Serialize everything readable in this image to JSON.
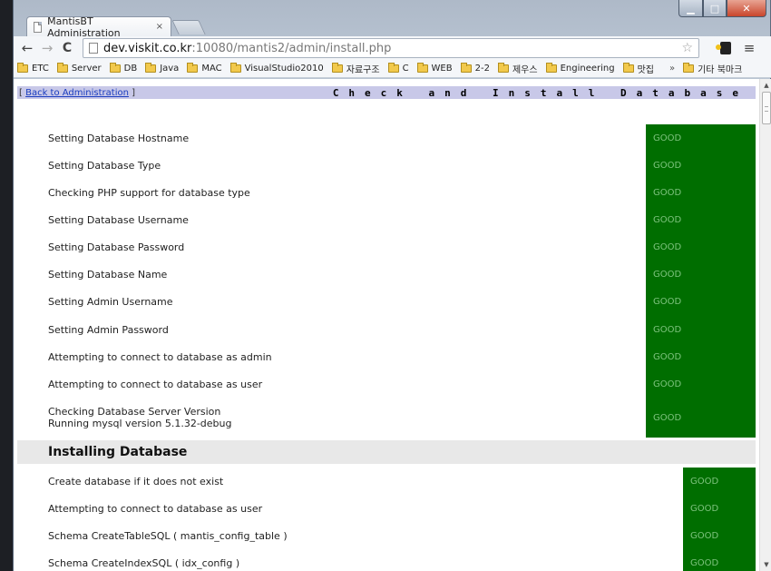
{
  "browser": {
    "tab_title": "MantisBT Administration",
    "tab_close": "×",
    "url_host": "dev.viskit.co.kr",
    "url_rest": ":10080/mantis2/admin/install.php",
    "bookmarks": [
      "ETC",
      "Server",
      "DB",
      "Java",
      "MAC",
      "VisualStudio2010",
      "자료구조",
      "C",
      "WEB",
      "2-2",
      "제우스",
      "Engineering",
      "맛집"
    ],
    "bookmarks_more": "»",
    "other_bookmarks": "기타 북마크"
  },
  "page": {
    "back_prefix": "[ ",
    "back_link": "Back to Administration",
    "back_suffix": " ]",
    "title": "Check and Install Database",
    "checks": [
      {
        "label": "Setting Database Hostname",
        "status": "GOOD"
      },
      {
        "label": "Setting Database Type",
        "status": "GOOD"
      },
      {
        "label": "Checking PHP support for database type",
        "status": "GOOD"
      },
      {
        "label": "Setting Database Username",
        "status": "GOOD"
      },
      {
        "label": "Setting Database Password",
        "status": "GOOD"
      },
      {
        "label": "Setting Database Name",
        "status": "GOOD"
      },
      {
        "label": "Setting Admin Username",
        "status": "GOOD"
      },
      {
        "label": "Setting Admin Password",
        "status": "GOOD"
      },
      {
        "label": "Attempting to connect to database as admin",
        "status": "GOOD"
      },
      {
        "label": "Attempting to connect to database as user",
        "status": "GOOD"
      },
      {
        "label": "Checking Database Server Version",
        "sublabel": "Running mysql version 5.1.32-debug",
        "status": "GOOD"
      }
    ],
    "section_title": "Installing Database",
    "install_steps": [
      {
        "label": "Create database if it does not exist",
        "status": "GOOD"
      },
      {
        "label": "Attempting to connect to database as user",
        "status": "GOOD"
      },
      {
        "label": "Schema CreateTableSQL ( mantis_config_table )",
        "status": "GOOD"
      },
      {
        "label": "Schema CreateIndexSQL ( idx_config )",
        "status": "GOOD"
      }
    ]
  },
  "colors": {
    "good_bg": "#006e00",
    "good_text": "#7ec37e",
    "header_bar": "#c8c8e8"
  }
}
